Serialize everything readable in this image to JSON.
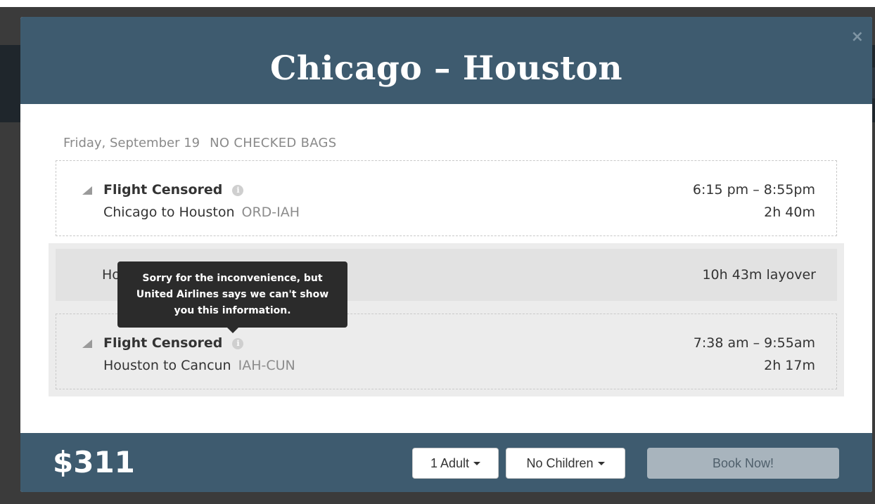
{
  "modal": {
    "title": "Chicago – Houston",
    "close_label": "×"
  },
  "trip": {
    "date": "Friday, September 19",
    "bags": "NO CHECKED BAGS"
  },
  "segments": [
    {
      "icon": "plane-icon",
      "flight": "Flight Censored",
      "route": "Chicago to Houston",
      "codes": "ORD-IAH",
      "times": "6:15 pm – 8:55pm",
      "duration": "2h 40m"
    },
    {
      "icon": "plane-icon",
      "flight": "Flight Censored",
      "route": "Houston to Cancun",
      "codes": "IAH-CUN",
      "times": "7:38 am – 9:55am",
      "duration": "2h 17m"
    }
  ],
  "layover": {
    "city": "Houston, IAH",
    "text": "10h 43m layover"
  },
  "tooltip": {
    "text": "Sorry for the inconvenience, but United Airlines says we can't show you this information."
  },
  "footer": {
    "price": "$311",
    "adults": "1 Adult",
    "children": "No Children",
    "book": "Book Now!"
  },
  "icons": {
    "info": "i"
  }
}
